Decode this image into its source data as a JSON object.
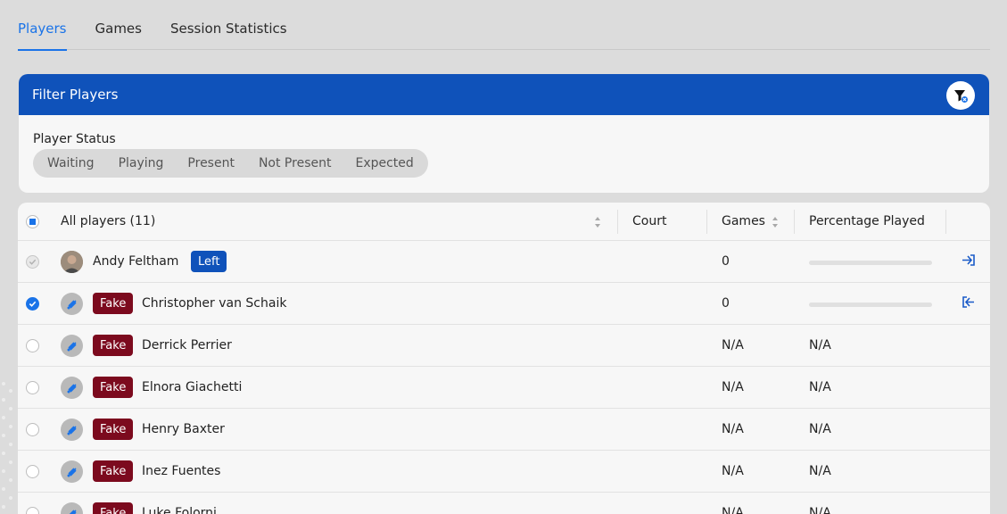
{
  "tabs": [
    {
      "label": "Players",
      "active": true
    },
    {
      "label": "Games",
      "active": false
    },
    {
      "label": "Session Statistics",
      "active": false
    }
  ],
  "filter": {
    "title": "Filter Players",
    "status_label": "Player Status",
    "options": [
      "Waiting",
      "Playing",
      "Present",
      "Not Present",
      "Expected"
    ]
  },
  "table": {
    "header": {
      "all_players": "All players (11)",
      "court": "Court",
      "games": "Games",
      "percentage": "Percentage Played"
    },
    "rows": [
      {
        "name": "Andy Feltham",
        "badge": "Left",
        "games": "0",
        "percentage": "",
        "progress": 0
      },
      {
        "name": "Christopher van Schaik",
        "badge": "Fake",
        "games": "0",
        "percentage": "",
        "progress": 0
      },
      {
        "name": "Derrick Perrier",
        "badge": "Fake",
        "games": "N/A",
        "percentage": "N/A"
      },
      {
        "name": "Elnora Giachetti",
        "badge": "Fake",
        "games": "N/A",
        "percentage": "N/A"
      },
      {
        "name": "Henry Baxter",
        "badge": "Fake",
        "games": "N/A",
        "percentage": "N/A"
      },
      {
        "name": "Inez Fuentes",
        "badge": "Fake",
        "games": "N/A",
        "percentage": "N/A"
      },
      {
        "name": "Luke Folorni",
        "badge": "Fake",
        "games": "N/A",
        "percentage": "N/A"
      }
    ]
  },
  "colors": {
    "accent": "#1a73e8",
    "header": "#0f52ba",
    "fake_badge": "#7c0a1e"
  },
  "icons": {
    "filter": "filter-clear-icon",
    "checkin": "login-icon",
    "checkout": "logout-icon"
  }
}
